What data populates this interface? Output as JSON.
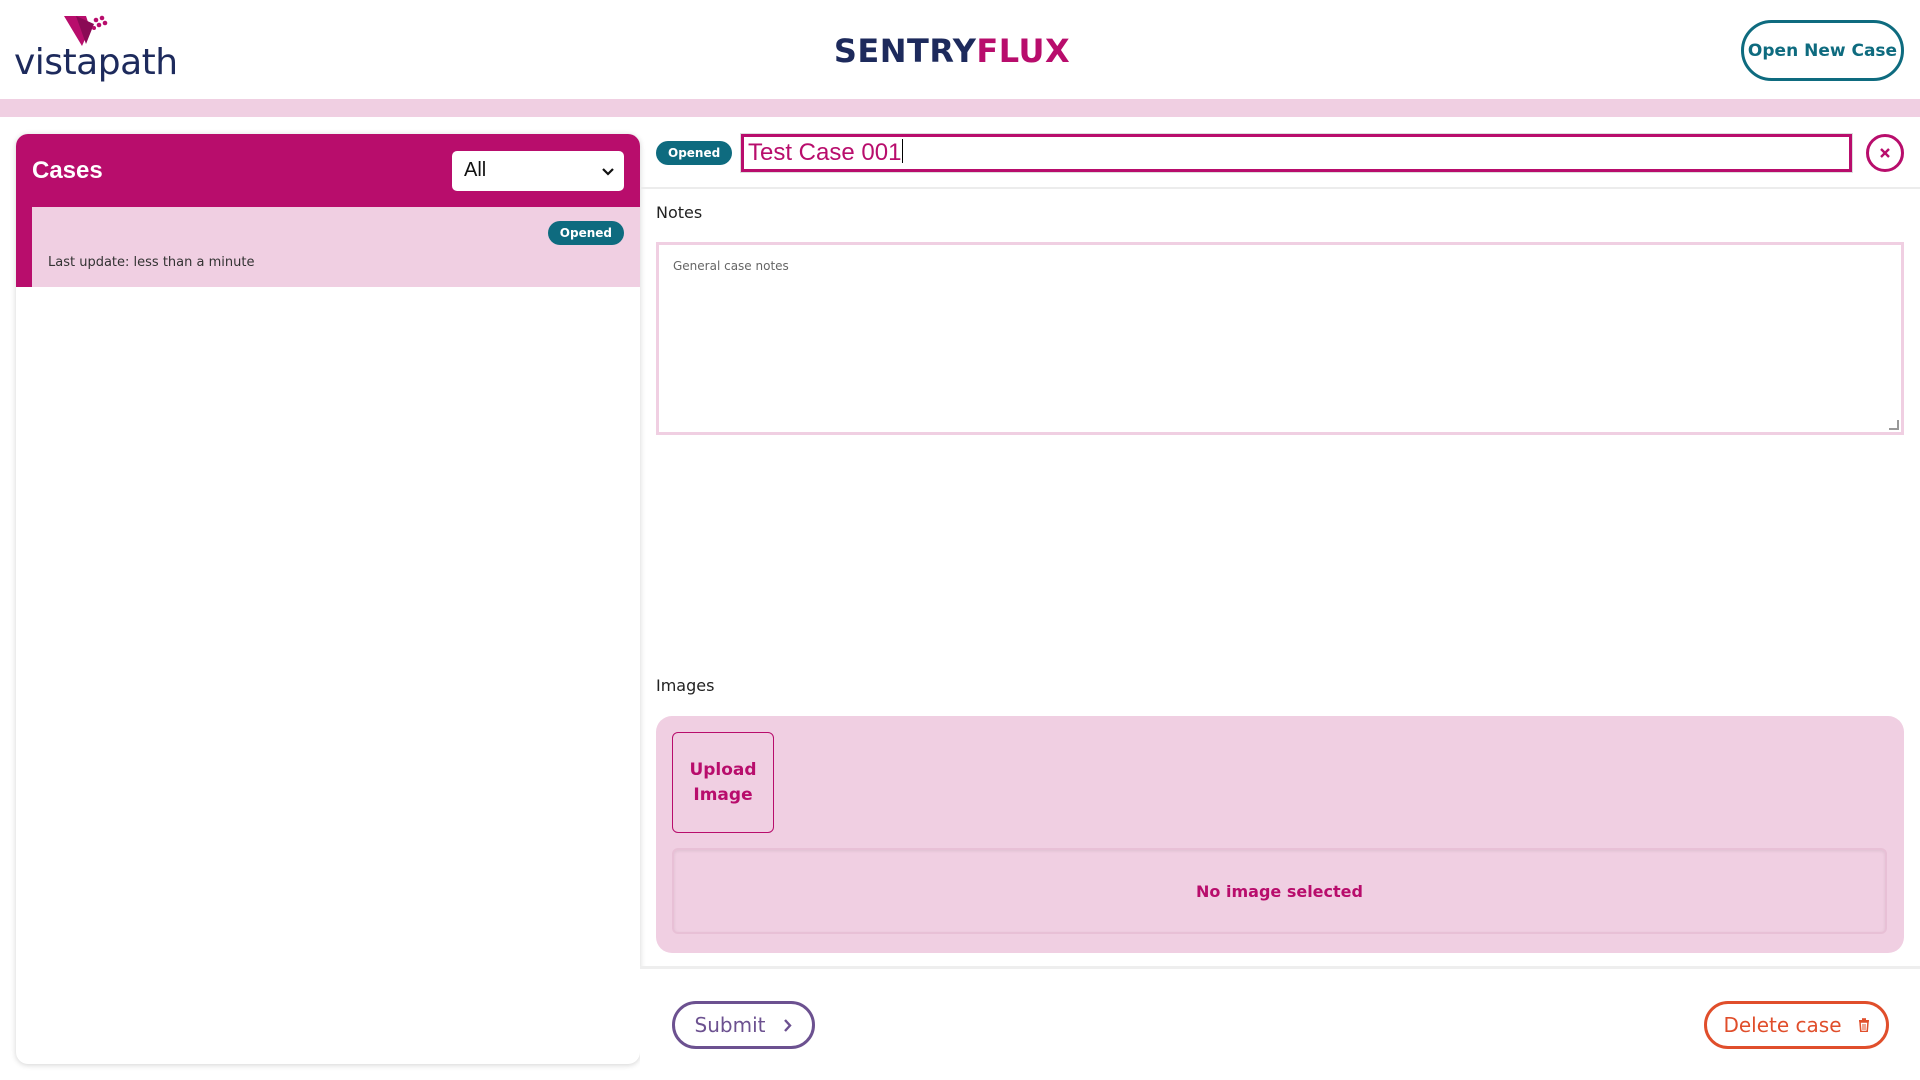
{
  "header": {
    "logo_text": "vistapath",
    "brand_part1": "SENTRY",
    "brand_part2": "FLUX",
    "open_new_case_label": "Open New Case"
  },
  "sidebar": {
    "title": "Cases",
    "filter": {
      "selected": "All"
    },
    "cases": [
      {
        "status": "Opened",
        "last_update": "Last update: less than a minute"
      }
    ]
  },
  "case": {
    "status": "Opened",
    "title_value": "Test Case 001",
    "notes_label": "Notes",
    "notes_placeholder": "General case notes",
    "notes_value": "",
    "images_label": "Images",
    "upload_label": "Upload Image",
    "no_image_text": "No image selected"
  },
  "footer": {
    "submit_label": "Submit",
    "delete_label": "Delete case"
  },
  "colors": {
    "brand_magenta": "#b80d6c",
    "teal": "#0e6b7f",
    "navy": "#1d2a5c",
    "pink_light": "#f0cfe2",
    "purple": "#6c5190",
    "danger": "#e04e2b"
  },
  "icons": {
    "logo": "vistapath-logo-icon",
    "close": "close-icon",
    "dropdown": "chevron-down-icon",
    "submit": "chevron-right-icon",
    "delete": "trash-icon"
  }
}
